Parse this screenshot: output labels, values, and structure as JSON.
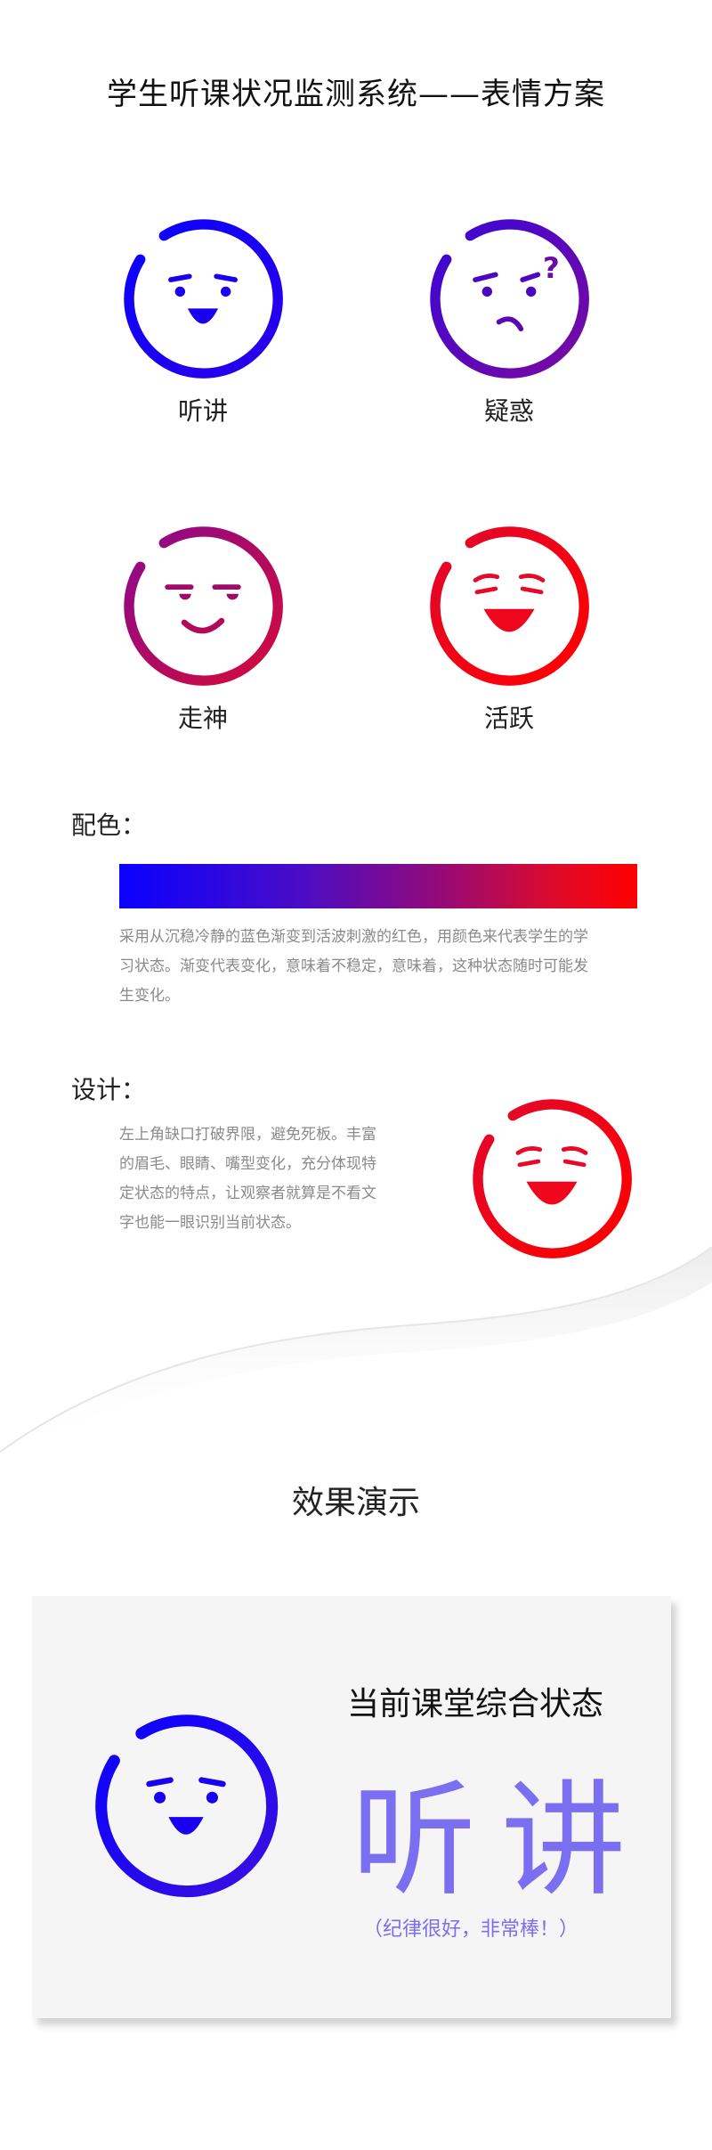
{
  "title": "学生听课状况监测系统——表情方案",
  "faces": [
    {
      "label": "听讲",
      "color_start": "#0a00ff",
      "color_end": "#2a00e8"
    },
    {
      "label": "疑惑",
      "color_start": "#3a06d6",
      "color_end": "#7a0aa0"
    },
    {
      "label": "走神",
      "color_start": "#8a0a8c",
      "color_end": "#d40a3a"
    },
    {
      "label": "活跃",
      "color_start": "#e0082c",
      "color_end": "#ff0000"
    }
  ],
  "color_section": {
    "heading": "配色：",
    "description_lines": [
      "采用从沉稳冷静的蓝色渐变到活波刺激的红色，用颜色来代表学生的学",
      "习状态。渐变代表变化，意味着不稳定，意味着，这种状态随时可能发",
      "生变化。"
    ]
  },
  "design_section": {
    "heading": "设计：",
    "description_lines": [
      "左上角缺口打破界限，避免死板。丰富",
      "的眉毛、眼睛、嘴型变化，充分体现特",
      "定状态的特点，让观察者就算是不看文",
      "字也能一眼识别当前状态。"
    ]
  },
  "demo": {
    "title": "效果演示",
    "heading": "当前课堂综合状态",
    "state": "听讲",
    "note": "（纪律很好，非常棒！）",
    "accent": "#7b6ef0"
  }
}
